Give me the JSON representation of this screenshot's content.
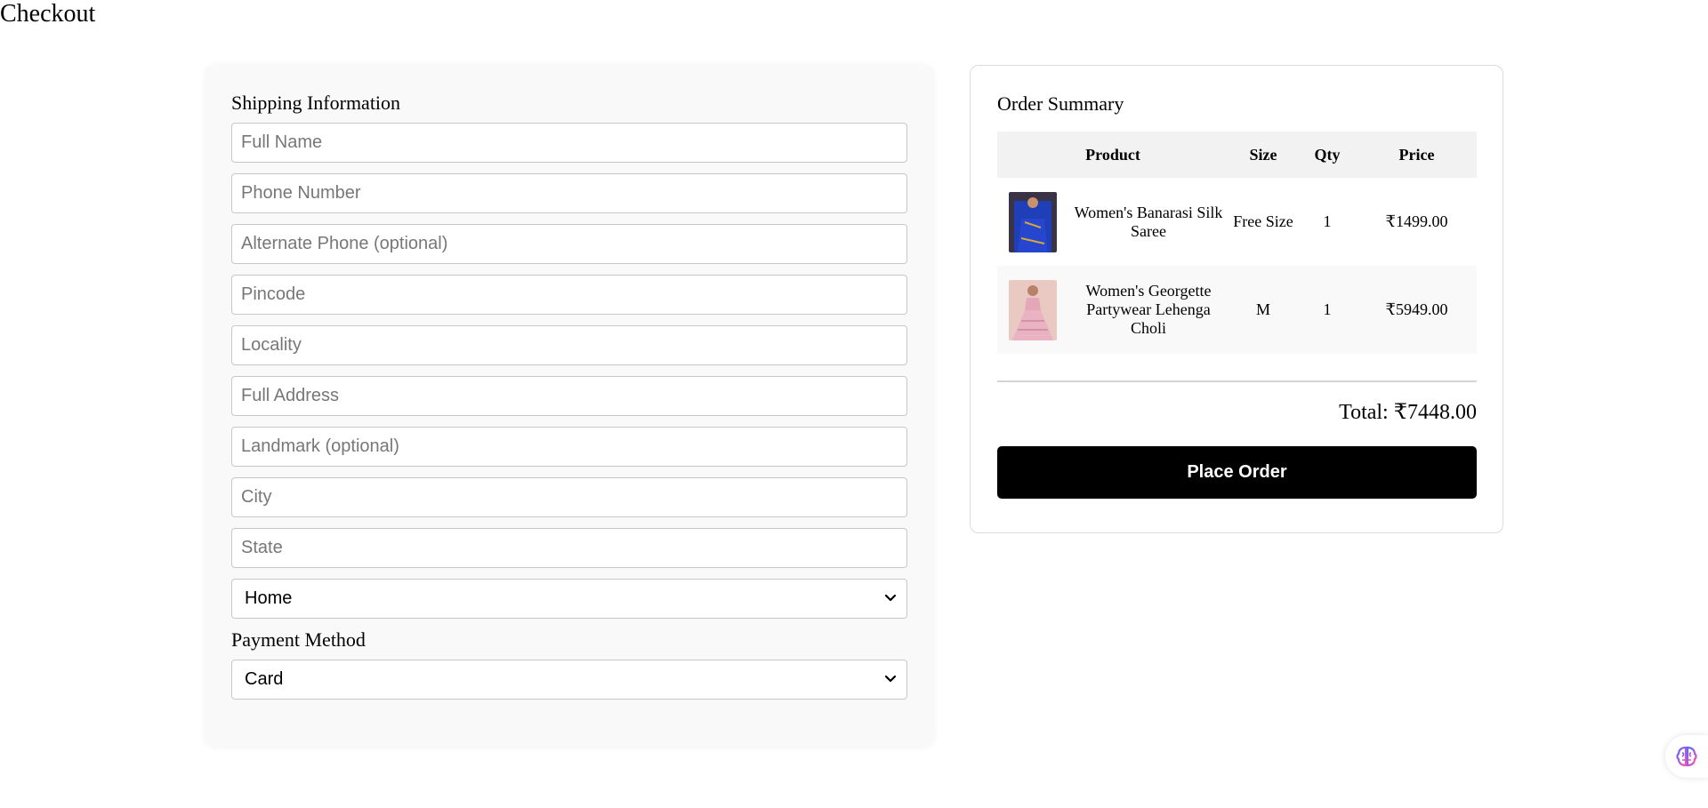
{
  "page": {
    "title": "Checkout"
  },
  "shipping": {
    "heading": "Shipping Information",
    "fields": {
      "full_name": "Full Name",
      "phone": "Phone Number",
      "alt_phone": "Alternate Phone (optional)",
      "pincode": "Pincode",
      "locality": "Locality",
      "address": "Full Address",
      "landmark": "Landmark (optional)",
      "city": "City",
      "state": "State"
    },
    "address_type": {
      "selected": "Home"
    },
    "payment_heading": "Payment Method",
    "payment_method": {
      "selected": "Card"
    }
  },
  "summary": {
    "heading": "Order Summary",
    "columns": {
      "product": "Product",
      "size": "Size",
      "qty": "Qty",
      "price": "Price"
    },
    "items": [
      {
        "name": "Women's Banarasi Silk Saree",
        "size": "Free Size",
        "qty": "1",
        "price": "₹1499.00",
        "thumb_color": "#1f3fb8"
      },
      {
        "name": "Women's Georgette Partywear Lehenga Choli",
        "size": "M",
        "qty": "1",
        "price": "₹5949.00",
        "thumb_color": "#e8b3c2"
      }
    ],
    "total": "Total: ₹7448.00",
    "place_order_label": "Place Order"
  },
  "colors": {
    "button_bg": "#000000",
    "card_bg": "#f9f9f9"
  },
  "icons": {
    "assistant": "brain-icon",
    "select": "chevron-down-icon"
  }
}
